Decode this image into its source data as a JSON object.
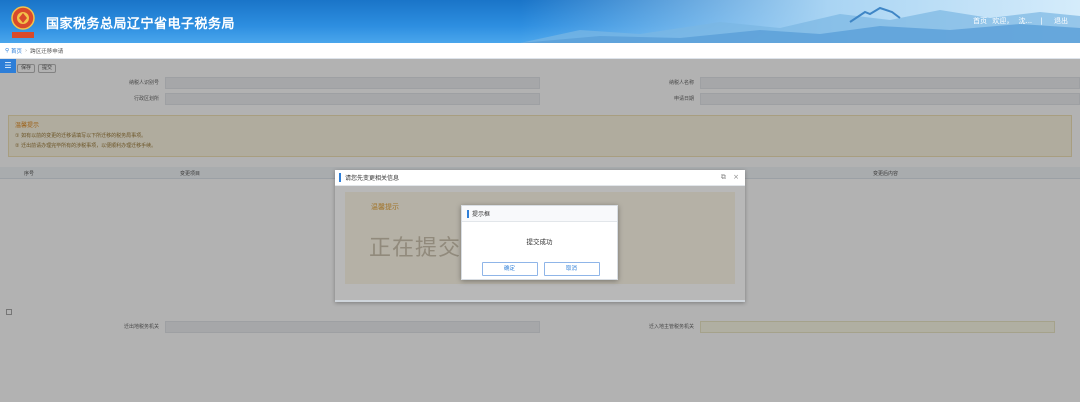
{
  "header": {
    "title": "国家税务总局辽宁省电子税务局",
    "logo_text": "中国税务",
    "nav_home": "首页",
    "nav_welcome": "欢迎，",
    "nav_user": "沈...",
    "nav_logout": "退出"
  },
  "breadcrumb": {
    "home": "首页",
    "current": "跨区迁移申请"
  },
  "page": {
    "menu_icon": "menu-icon",
    "toolbar": [
      "保存",
      "提交"
    ],
    "row1": {
      "label_left": "纳税人识别号",
      "label_right": "纳税人名称"
    },
    "row2": {
      "label_left": "行政区划所",
      "label_right": "申请日期"
    },
    "warm_title": "温馨提示",
    "warm_lines": [
      "①  如有以前的变更的迁移请填写以下所迁移的税务局事项。",
      "②  迁出前请办理完毕所有的涉税事项，以便顺利办理迁移手续。"
    ],
    "table_headers": [
      "序号",
      "变更项目",
      "变更后内容"
    ],
    "row3": {
      "label_left": "迁出地税务机关",
      "label_right": "迁入地主管税务机关"
    }
  },
  "dialog": {
    "title": "请您先变更相关信息",
    "warm_title": "温馨提示",
    "big_text": "正在提交数"
  },
  "prompt": {
    "title": "提示框",
    "message": "提交成功",
    "confirm_label": "确定",
    "cancel_label": "取消"
  },
  "colors": {
    "accent": "#2d7ed8",
    "header_blue": "#1a74c8"
  }
}
